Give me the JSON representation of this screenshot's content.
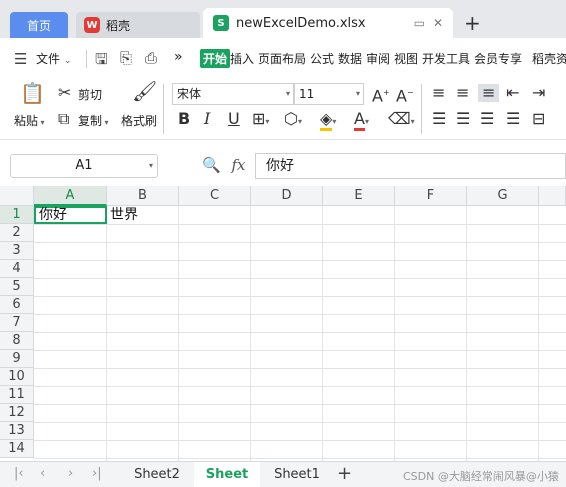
{
  "tabs": {
    "home": "首页",
    "wps": "稻壳",
    "doc": "newExcelDemo.xlsx"
  },
  "menu": {
    "file": "文件",
    "more": "»",
    "items": [
      "开始",
      "插入",
      "页面布局",
      "公式",
      "数据",
      "审阅",
      "视图",
      "开发工具",
      "会员专享",
      "稻壳资"
    ]
  },
  "toolbar": {
    "paste": "粘贴",
    "cut": "剪切",
    "copy": "复制",
    "format_painter": "格式刷",
    "font_name": "宋体",
    "font_size": "11"
  },
  "formula_bar": {
    "cell_ref": "A1",
    "fx": "fx",
    "value": "你好"
  },
  "grid": {
    "columns": [
      "A",
      "B",
      "C",
      "D",
      "E",
      "F",
      "G"
    ],
    "rows": [
      "1",
      "2",
      "3",
      "4",
      "5",
      "6",
      "7",
      "8",
      "9",
      "10",
      "11",
      "12",
      "13",
      "14"
    ],
    "a1": "你好",
    "b1": "世界"
  },
  "sheets": {
    "tabs": [
      "Sheet2",
      "Sheet",
      "Sheet1"
    ],
    "active": "Sheet",
    "add": "+"
  },
  "watermark": "CSDN @大脑经常闹风暴@小猿",
  "colors": {
    "accent": "#1aa260",
    "home_tab": "#5b8def"
  }
}
